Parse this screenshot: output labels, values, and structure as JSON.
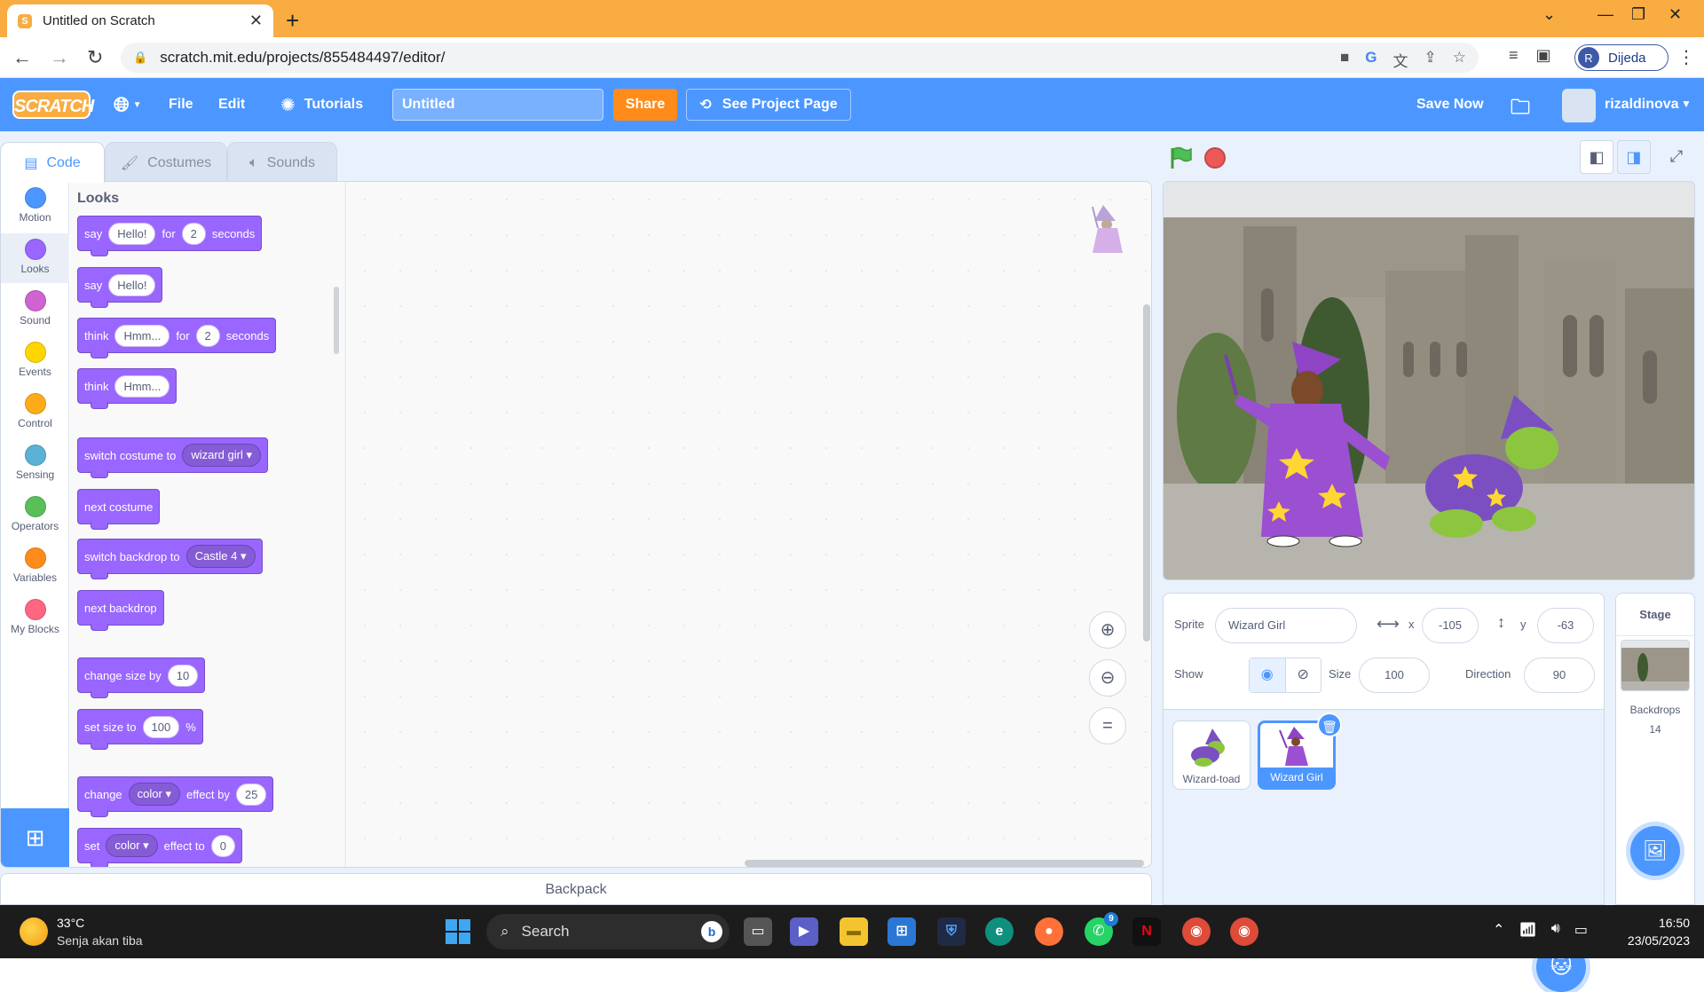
{
  "browser": {
    "tab_title": "Untitled on Scratch",
    "url": "scratch.mit.edu/projects/855484497/editor/",
    "profile_initial": "R",
    "profile_name": "Dijeda"
  },
  "menubar": {
    "logo": "SCRATCH",
    "file": "File",
    "edit": "Edit",
    "tutorials": "Tutorials",
    "project_title": "Untitled",
    "share": "Share",
    "see_project_page": "See Project Page",
    "save_now": "Save Now",
    "username": "rizaldinova"
  },
  "editor_tabs": [
    "Code",
    "Costumes",
    "Sounds"
  ],
  "categories": [
    {
      "label": "Motion",
      "color": "#4c97ff"
    },
    {
      "label": "Looks",
      "color": "#9966ff"
    },
    {
      "label": "Sound",
      "color": "#cf63cf"
    },
    {
      "label": "Events",
      "color": "#ffd500"
    },
    {
      "label": "Control",
      "color": "#ffab19"
    },
    {
      "label": "Sensing",
      "color": "#5cb1d6"
    },
    {
      "label": "Operators",
      "color": "#59c059"
    },
    {
      "label": "Variables",
      "color": "#ff8c1a"
    },
    {
      "label": "My Blocks",
      "color": "#ff6680"
    }
  ],
  "palette": {
    "title": "Looks",
    "blocks": {
      "say_for": {
        "w1": "say",
        "v1": "Hello!",
        "w2": "for",
        "v2": "2",
        "w3": "seconds"
      },
      "say": {
        "w1": "say",
        "v1": "Hello!"
      },
      "think_for": {
        "w1": "think",
        "v1": "Hmm...",
        "w2": "for",
        "v2": "2",
        "w3": "seconds"
      },
      "think": {
        "w1": "think",
        "v1": "Hmm..."
      },
      "switch_costume": {
        "w1": "switch costume to",
        "v1": "wizard girl"
      },
      "next_costume": {
        "w1": "next costume"
      },
      "switch_backdrop": {
        "w1": "switch backdrop to",
        "v1": "Castle 4"
      },
      "next_backdrop": {
        "w1": "next backdrop"
      },
      "change_size": {
        "w1": "change size by",
        "v1": "10"
      },
      "set_size": {
        "w1": "set size to",
        "v1": "100",
        "w2": "%"
      },
      "change_effect": {
        "w1": "change",
        "v1": "color",
        "w2": "effect by",
        "v2": "25"
      },
      "set_effect": {
        "w1": "set",
        "v1": "color",
        "w2": "effect to",
        "v2": "0"
      }
    }
  },
  "backpack": "Backpack",
  "sprite_info": {
    "sprite_label": "Sprite",
    "sprite_name": "Wizard Girl",
    "x_label": "x",
    "x": "-105",
    "y_label": "y",
    "y": "-63",
    "show_label": "Show",
    "size_label": "Size",
    "size": "100",
    "direction_label": "Direction",
    "direction": "90"
  },
  "sprites": [
    {
      "name": "Wizard-toad",
      "selected": false
    },
    {
      "name": "Wizard Girl",
      "selected": true
    }
  ],
  "stage_panel": {
    "title": "Stage",
    "backdrops_label": "Backdrops",
    "backdrops_count": "14"
  },
  "taskbar": {
    "temperature": "33°C",
    "weather_desc": "Senja akan tiba",
    "search": "Search",
    "whatsapp_badge": "9",
    "time": "16:50",
    "date": "23/05/2023"
  }
}
